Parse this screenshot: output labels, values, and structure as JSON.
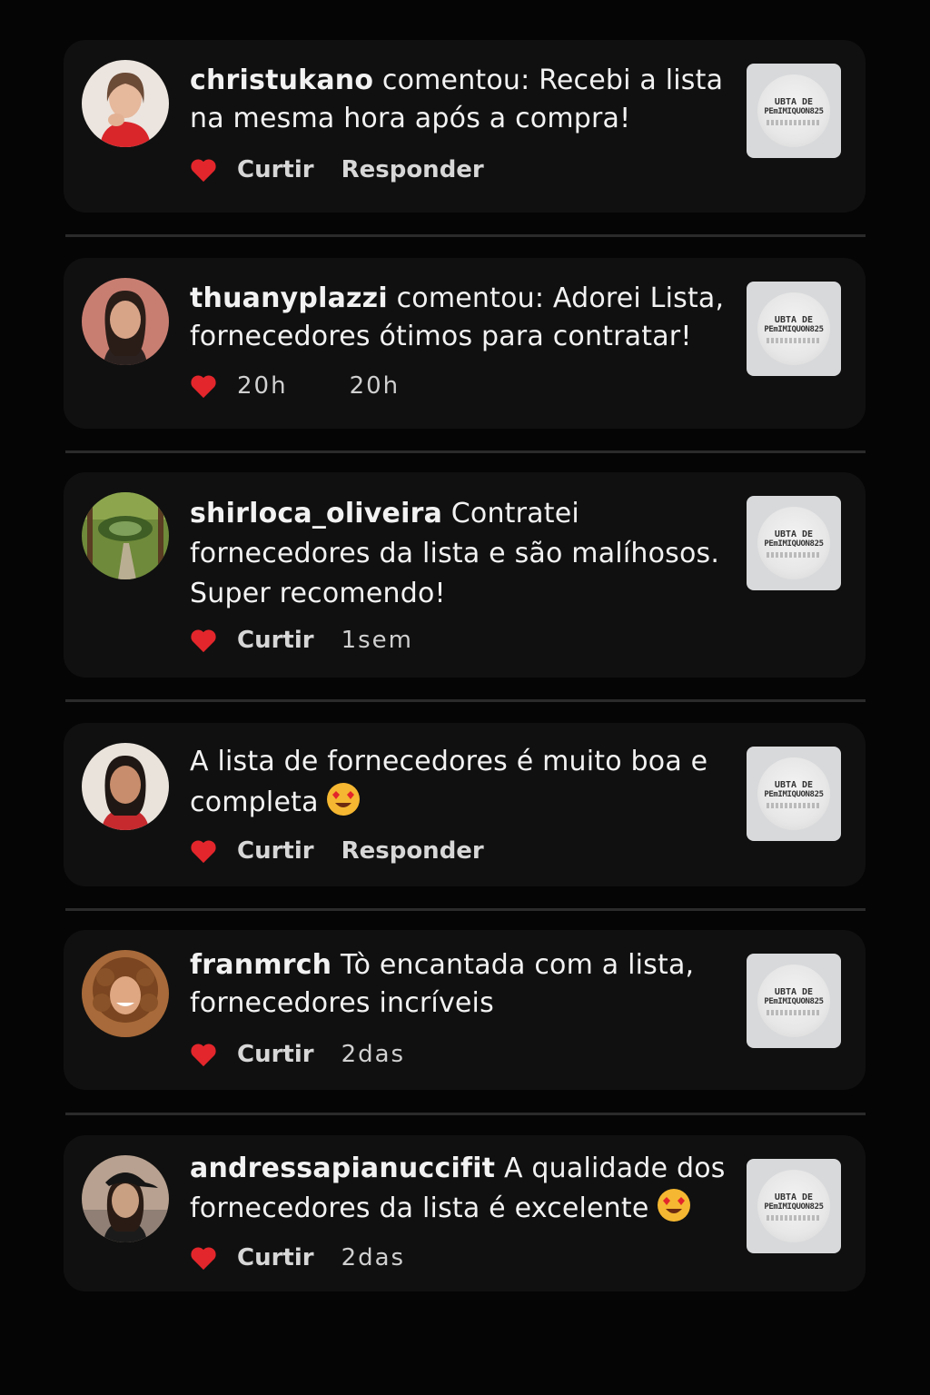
{
  "comments": [
    {
      "username": "christukano",
      "text": " comentou: Recebi a lista na mesma hora após a compra!",
      "action1": "Curtir",
      "action2": "Responder",
      "avatar_icon": "woman-avatar"
    },
    {
      "username": "thuanyplazzi",
      "text": " comentou: Adorei Lista, fornecedores ótimos para contratar!",
      "action1": "20h",
      "action2": "20h",
      "avatar_icon": "woman-avatar"
    },
    {
      "username": "shirloca_oliveira",
      "text": " Contratei fornecedores da lista e são malíhosos. Super recomendo!",
      "action1": "Curtir",
      "action2": "1sem",
      "avatar_icon": "garden-avatar"
    },
    {
      "username": "",
      "text": "A lista de fornecedores é muito boa e completa",
      "action1": "Curtir",
      "action2": "Responder",
      "avatar_icon": "woman-avatar"
    },
    {
      "username": "franmrch",
      "text": " Tò encantada com a lista, fornecedores incríveis",
      "action1": "Curtir",
      "action2": "2das",
      "avatar_icon": "woman-avatar"
    },
    {
      "username": "andressapianuccifit",
      "text": " A qualidade dos fornecedores da lista é excelente",
      "action1": "Curtir",
      "action2": "2das",
      "avatar_icon": "woman-avatar"
    }
  ],
  "thumbnail": {
    "line1": "UBTA DE",
    "line2": "PEmIMIQUON825"
  },
  "colors": {
    "background": "#050505",
    "card": "#101010",
    "heart": "#e3262b",
    "divider": "#2b2b2b"
  },
  "icons": [
    "heart-icon",
    "heart-eyes-emoji",
    "avatar"
  ]
}
